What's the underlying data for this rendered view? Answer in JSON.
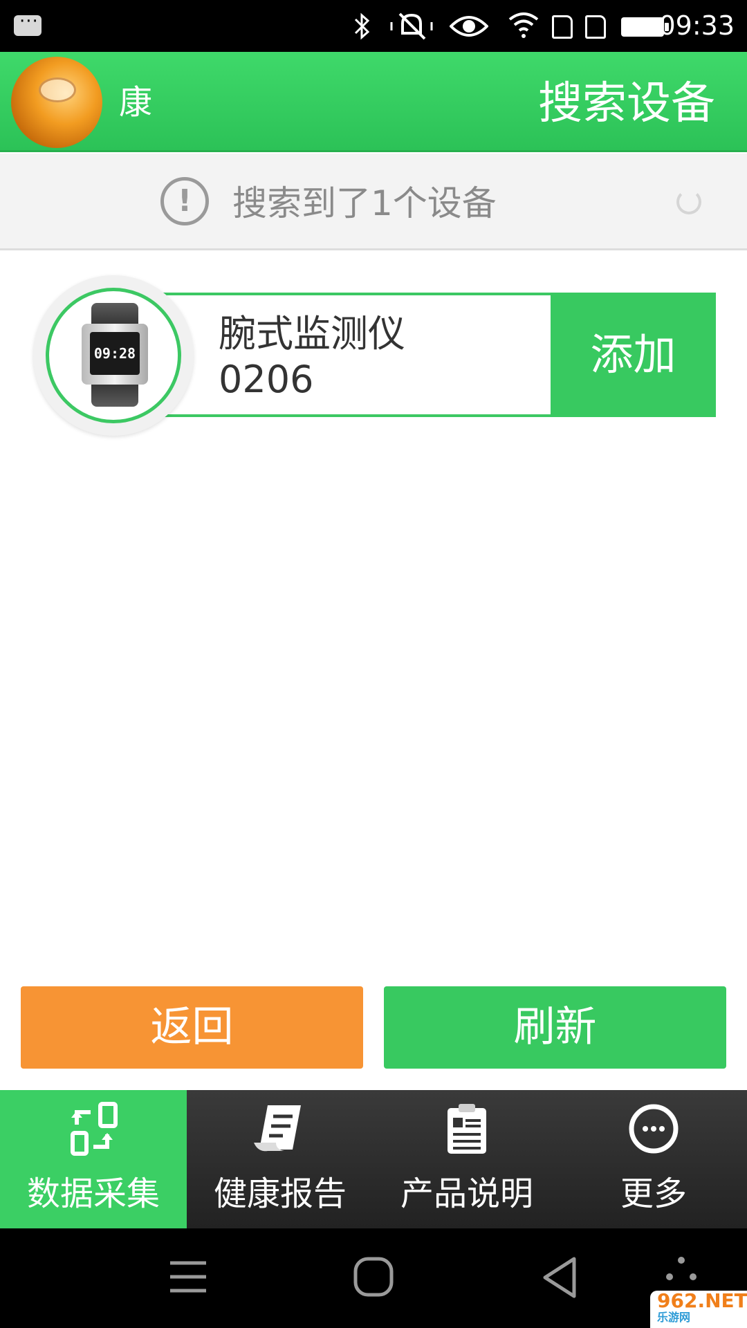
{
  "status_bar": {
    "time": "09:33",
    "icons": [
      "message-icon",
      "bluetooth-icon",
      "mute-icon",
      "eye-icon",
      "wifi-icon",
      "sim-icon",
      "sim-icon",
      "battery-icon"
    ]
  },
  "header": {
    "user_name": "康",
    "title": "搜索设备"
  },
  "search_status": {
    "message": "搜索到了1个设备"
  },
  "devices": [
    {
      "name": "腕式监测仪",
      "id": "0206",
      "watch_time": "09:28",
      "add_label": "添加"
    }
  ],
  "actions": {
    "back_label": "返回",
    "refresh_label": "刷新"
  },
  "tabs": [
    {
      "label": "数据采集",
      "icon": "data-sync-icon",
      "active": true
    },
    {
      "label": "健康报告",
      "icon": "report-icon",
      "active": false
    },
    {
      "label": "产品说明",
      "icon": "clipboard-icon",
      "active": false
    },
    {
      "label": "更多",
      "icon": "more-icon",
      "active": false
    }
  ],
  "colors": {
    "brand_green": "#38c960",
    "orange": "#f79434",
    "tab_bg": "#2b2b2b"
  },
  "watermark": {
    "brand": "962.NET",
    "sub": "乐游网"
  }
}
